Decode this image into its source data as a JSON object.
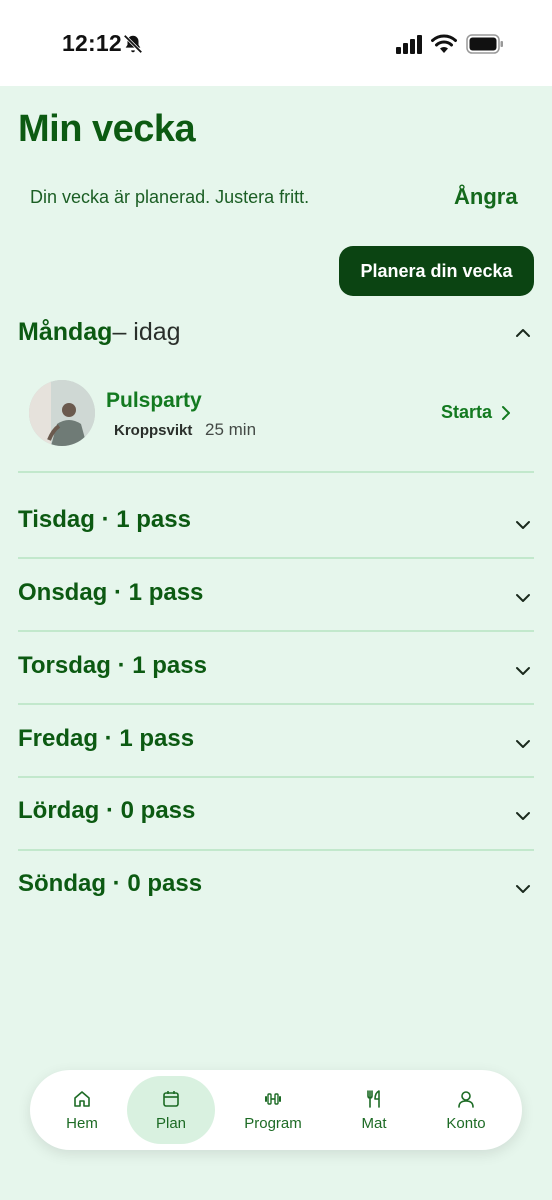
{
  "status_bar": {
    "time": "12:12"
  },
  "header": {
    "title": "Min vecka",
    "subtitle": "Din vecka är planerad. Justera fritt.",
    "undo_label": "Ångra",
    "plan_button": "Planera din vecka"
  },
  "today": {
    "day": "Måndag",
    "suffix": "– idag",
    "workout": {
      "name": "Pulsparty",
      "tag": "Kroppsvikt",
      "duration": "25 min",
      "start_label": "Starta"
    }
  },
  "days": [
    {
      "label": "Tisdag · 1 pass"
    },
    {
      "label": "Onsdag · 1 pass"
    },
    {
      "label": "Torsdag · 1 pass"
    },
    {
      "label": "Fredag · 1 pass"
    },
    {
      "label": "Lördag · 0 pass"
    },
    {
      "label": "Söndag · 0 pass"
    }
  ],
  "nav": [
    {
      "label": "Hem",
      "icon": "home-icon"
    },
    {
      "label": "Plan",
      "icon": "calendar-icon",
      "active": true
    },
    {
      "label": "Program",
      "icon": "dumbbell-icon"
    },
    {
      "label": "Mat",
      "icon": "fork-knife-icon"
    },
    {
      "label": "Konto",
      "icon": "person-icon"
    }
  ],
  "colors": {
    "accent": "#0c5a12",
    "button": "#0b4412",
    "background": "#e6f6ec"
  }
}
